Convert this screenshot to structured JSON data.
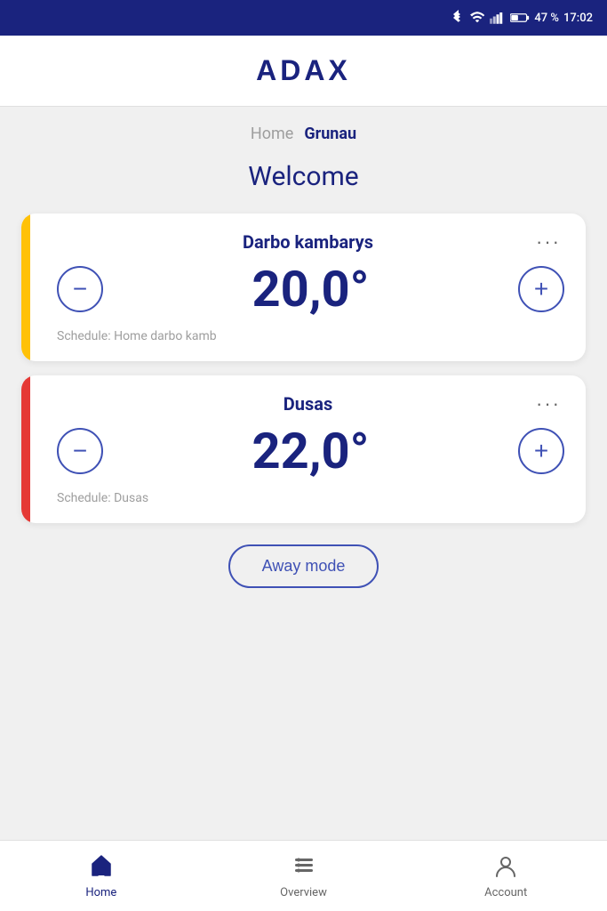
{
  "statusBar": {
    "battery": "47 %",
    "time": "17:02"
  },
  "header": {
    "logo": "ADAX"
  },
  "breadcrumb": {
    "parent": "Home",
    "current": "Grunau"
  },
  "welcome": {
    "title": "Welcome"
  },
  "devices": [
    {
      "id": "device-1",
      "name": "Darbo kambarys",
      "temperature": "20,0°",
      "schedule": "Schedule: Home darbo kamb",
      "accentColor": "yellow",
      "moreLabel": "···"
    },
    {
      "id": "device-2",
      "name": "Dusas",
      "temperature": "22,0°",
      "schedule": "Schedule: Dusas",
      "accentColor": "red",
      "moreLabel": "···"
    }
  ],
  "awayMode": {
    "label": "Away mode"
  },
  "bottomNav": {
    "items": [
      {
        "id": "home",
        "label": "Home",
        "active": true
      },
      {
        "id": "overview",
        "label": "Overview",
        "active": false
      },
      {
        "id": "account",
        "label": "Account",
        "active": false
      }
    ]
  }
}
